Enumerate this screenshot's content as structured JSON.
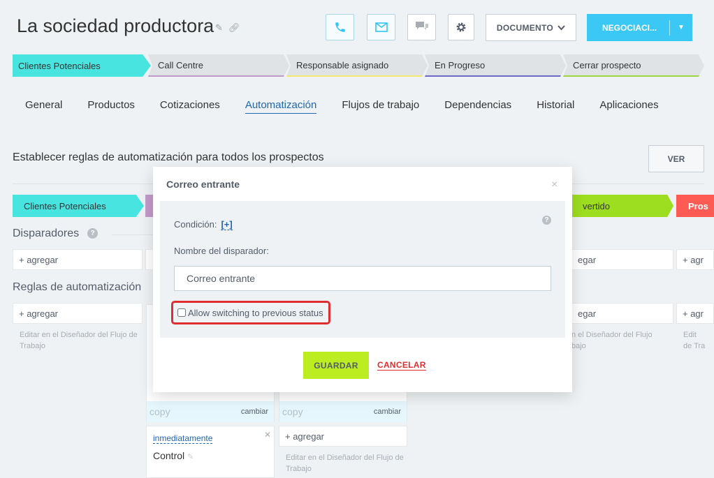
{
  "header": {
    "title": "La sociedad productora",
    "document_button": "DOCUMENTO",
    "negotiation_button": "NEGOCIACI..."
  },
  "stages": [
    {
      "label": "Clientes Potenciales"
    },
    {
      "label": "Call Centre"
    },
    {
      "label": "Responsable asignado"
    },
    {
      "label": "En Progreso"
    },
    {
      "label": "Cerrar prospecto"
    }
  ],
  "tabs": [
    "General",
    "Productos",
    "Cotizaciones",
    "Automatización",
    "Flujos de trabajo",
    "Dependencias",
    "Historial",
    "Aplicaciones"
  ],
  "automation": {
    "title": "Establecer reglas de automatización para todos los prospectos",
    "view_button": "VER",
    "columns": {
      "first": "Clientes Potenciales",
      "converted": "vertido",
      "last": "Pros"
    },
    "triggers_label": "Disparadores",
    "rules_label": "Reglas de automatización",
    "add_label": "+ agregar",
    "add_label_short": "+ agr",
    "add_label_cut": "egar",
    "edit_hint": "Editar en el Diseñador del Flujo de Trabajo",
    "edit_hint_cut": "n el Diseñador del Flujo\nbajo",
    "edit_hint_tiny": "Edit\nde Tra",
    "copy_label": "copy",
    "change_label": "cambiar",
    "card": {
      "timing": "inmediatamente",
      "name": "Control"
    }
  },
  "modal": {
    "title": "Correo entrante",
    "condition_label": "Condición:",
    "condition_link": "[+]",
    "trigger_name_label": "Nombre del disparador:",
    "trigger_name_value": "Correo entrante",
    "checkbox_label": "Allow switching to previous status",
    "checkbox_checked": false,
    "save_button": "GUARDAR",
    "cancel_link": "CANCELAR"
  },
  "colors": {
    "accent": "#3bc8f5",
    "stage_first": "#47e4e0",
    "save": "#bbed21",
    "danger": "#e02d2d"
  }
}
